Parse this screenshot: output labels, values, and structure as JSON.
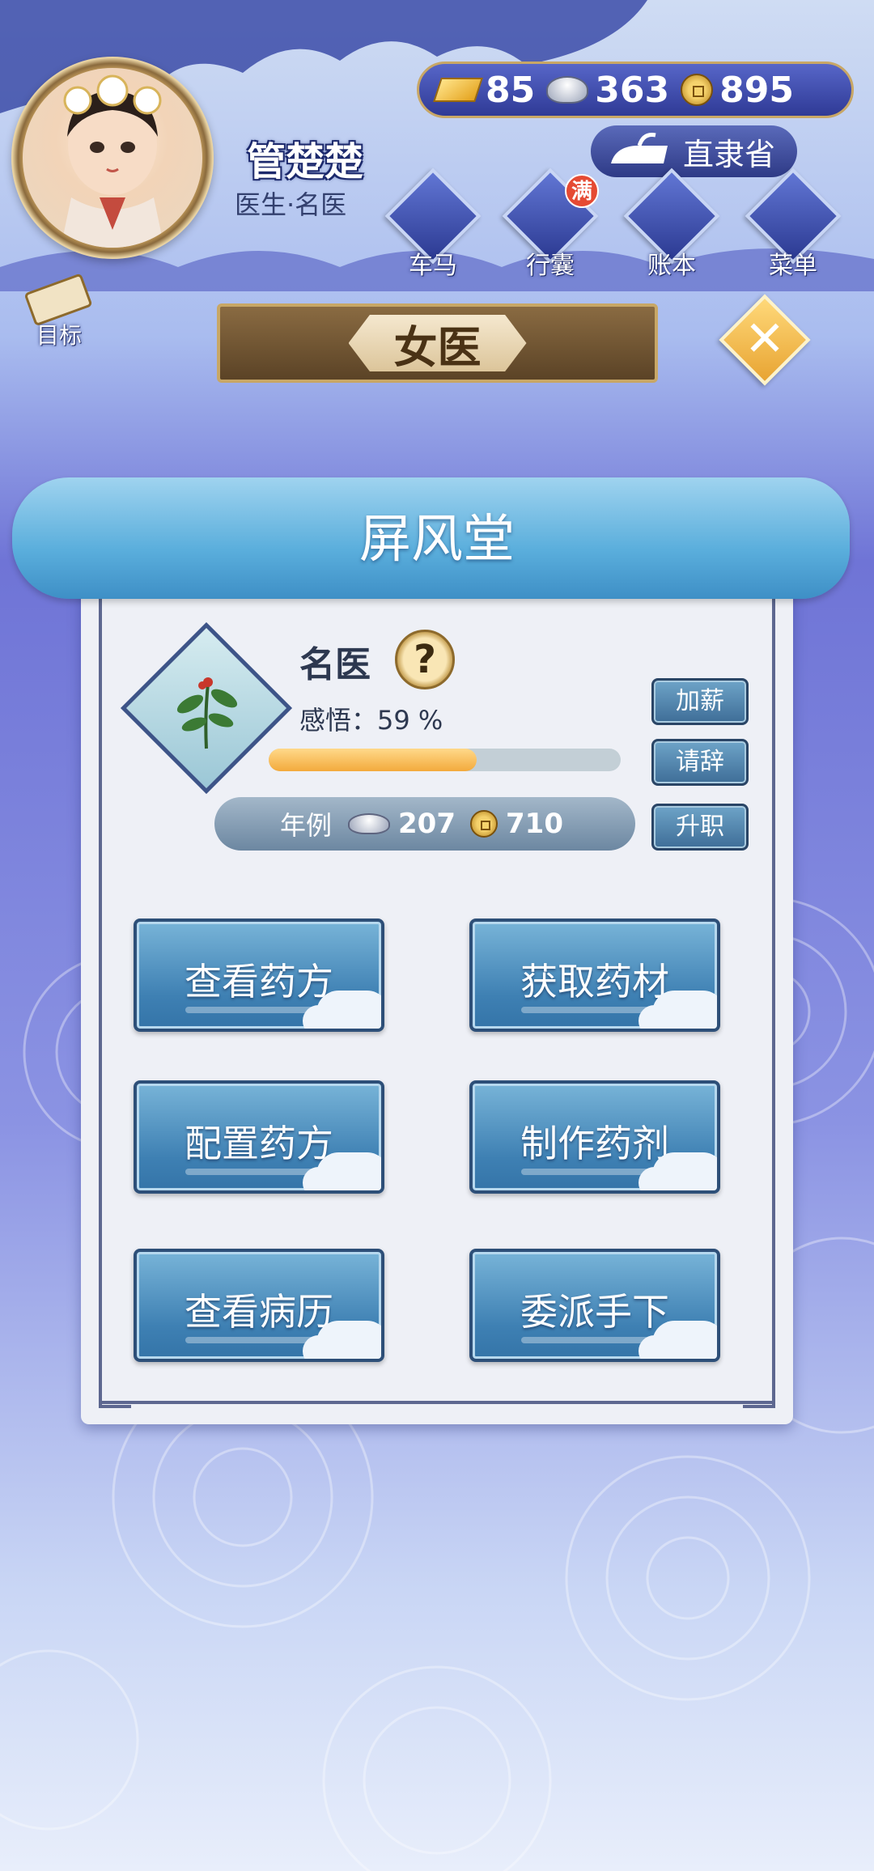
{
  "player": {
    "name": "管楚楚",
    "title": "医生·名医"
  },
  "currency": {
    "gold": "85",
    "silver": "363",
    "coins": "895"
  },
  "location": "直隶省",
  "nav": [
    {
      "label": "车马",
      "icon": "carriage-icon"
    },
    {
      "label": "行囊",
      "icon": "bag-icon",
      "badge": "满"
    },
    {
      "label": "账本",
      "icon": "ledger-icon"
    },
    {
      "label": "菜单",
      "icon": "menu-icon"
    }
  ],
  "goal_label": "目标",
  "role_banner": "女医",
  "panel": {
    "title": "屏风堂",
    "rank": "名医",
    "insight_label": "感悟：59 %",
    "insight_value": 59,
    "salary_label": "年例",
    "salary_silver": "207",
    "salary_coins": "710",
    "side_buttons": {
      "raise": "加薪",
      "resign": "请辞",
      "promote": "升职"
    },
    "actions": [
      {
        "label": "查看药方"
      },
      {
        "label": "获取药材"
      },
      {
        "label": "配置药方"
      },
      {
        "label": "制作药剂"
      },
      {
        "label": "查看病历"
      },
      {
        "label": "委派手下"
      }
    ]
  },
  "colors": {
    "accent_gold": "#c8a766",
    "panel_bg": "#eef0f6",
    "button_blue": "#3e80b3",
    "badge_red": "#e54a33"
  }
}
